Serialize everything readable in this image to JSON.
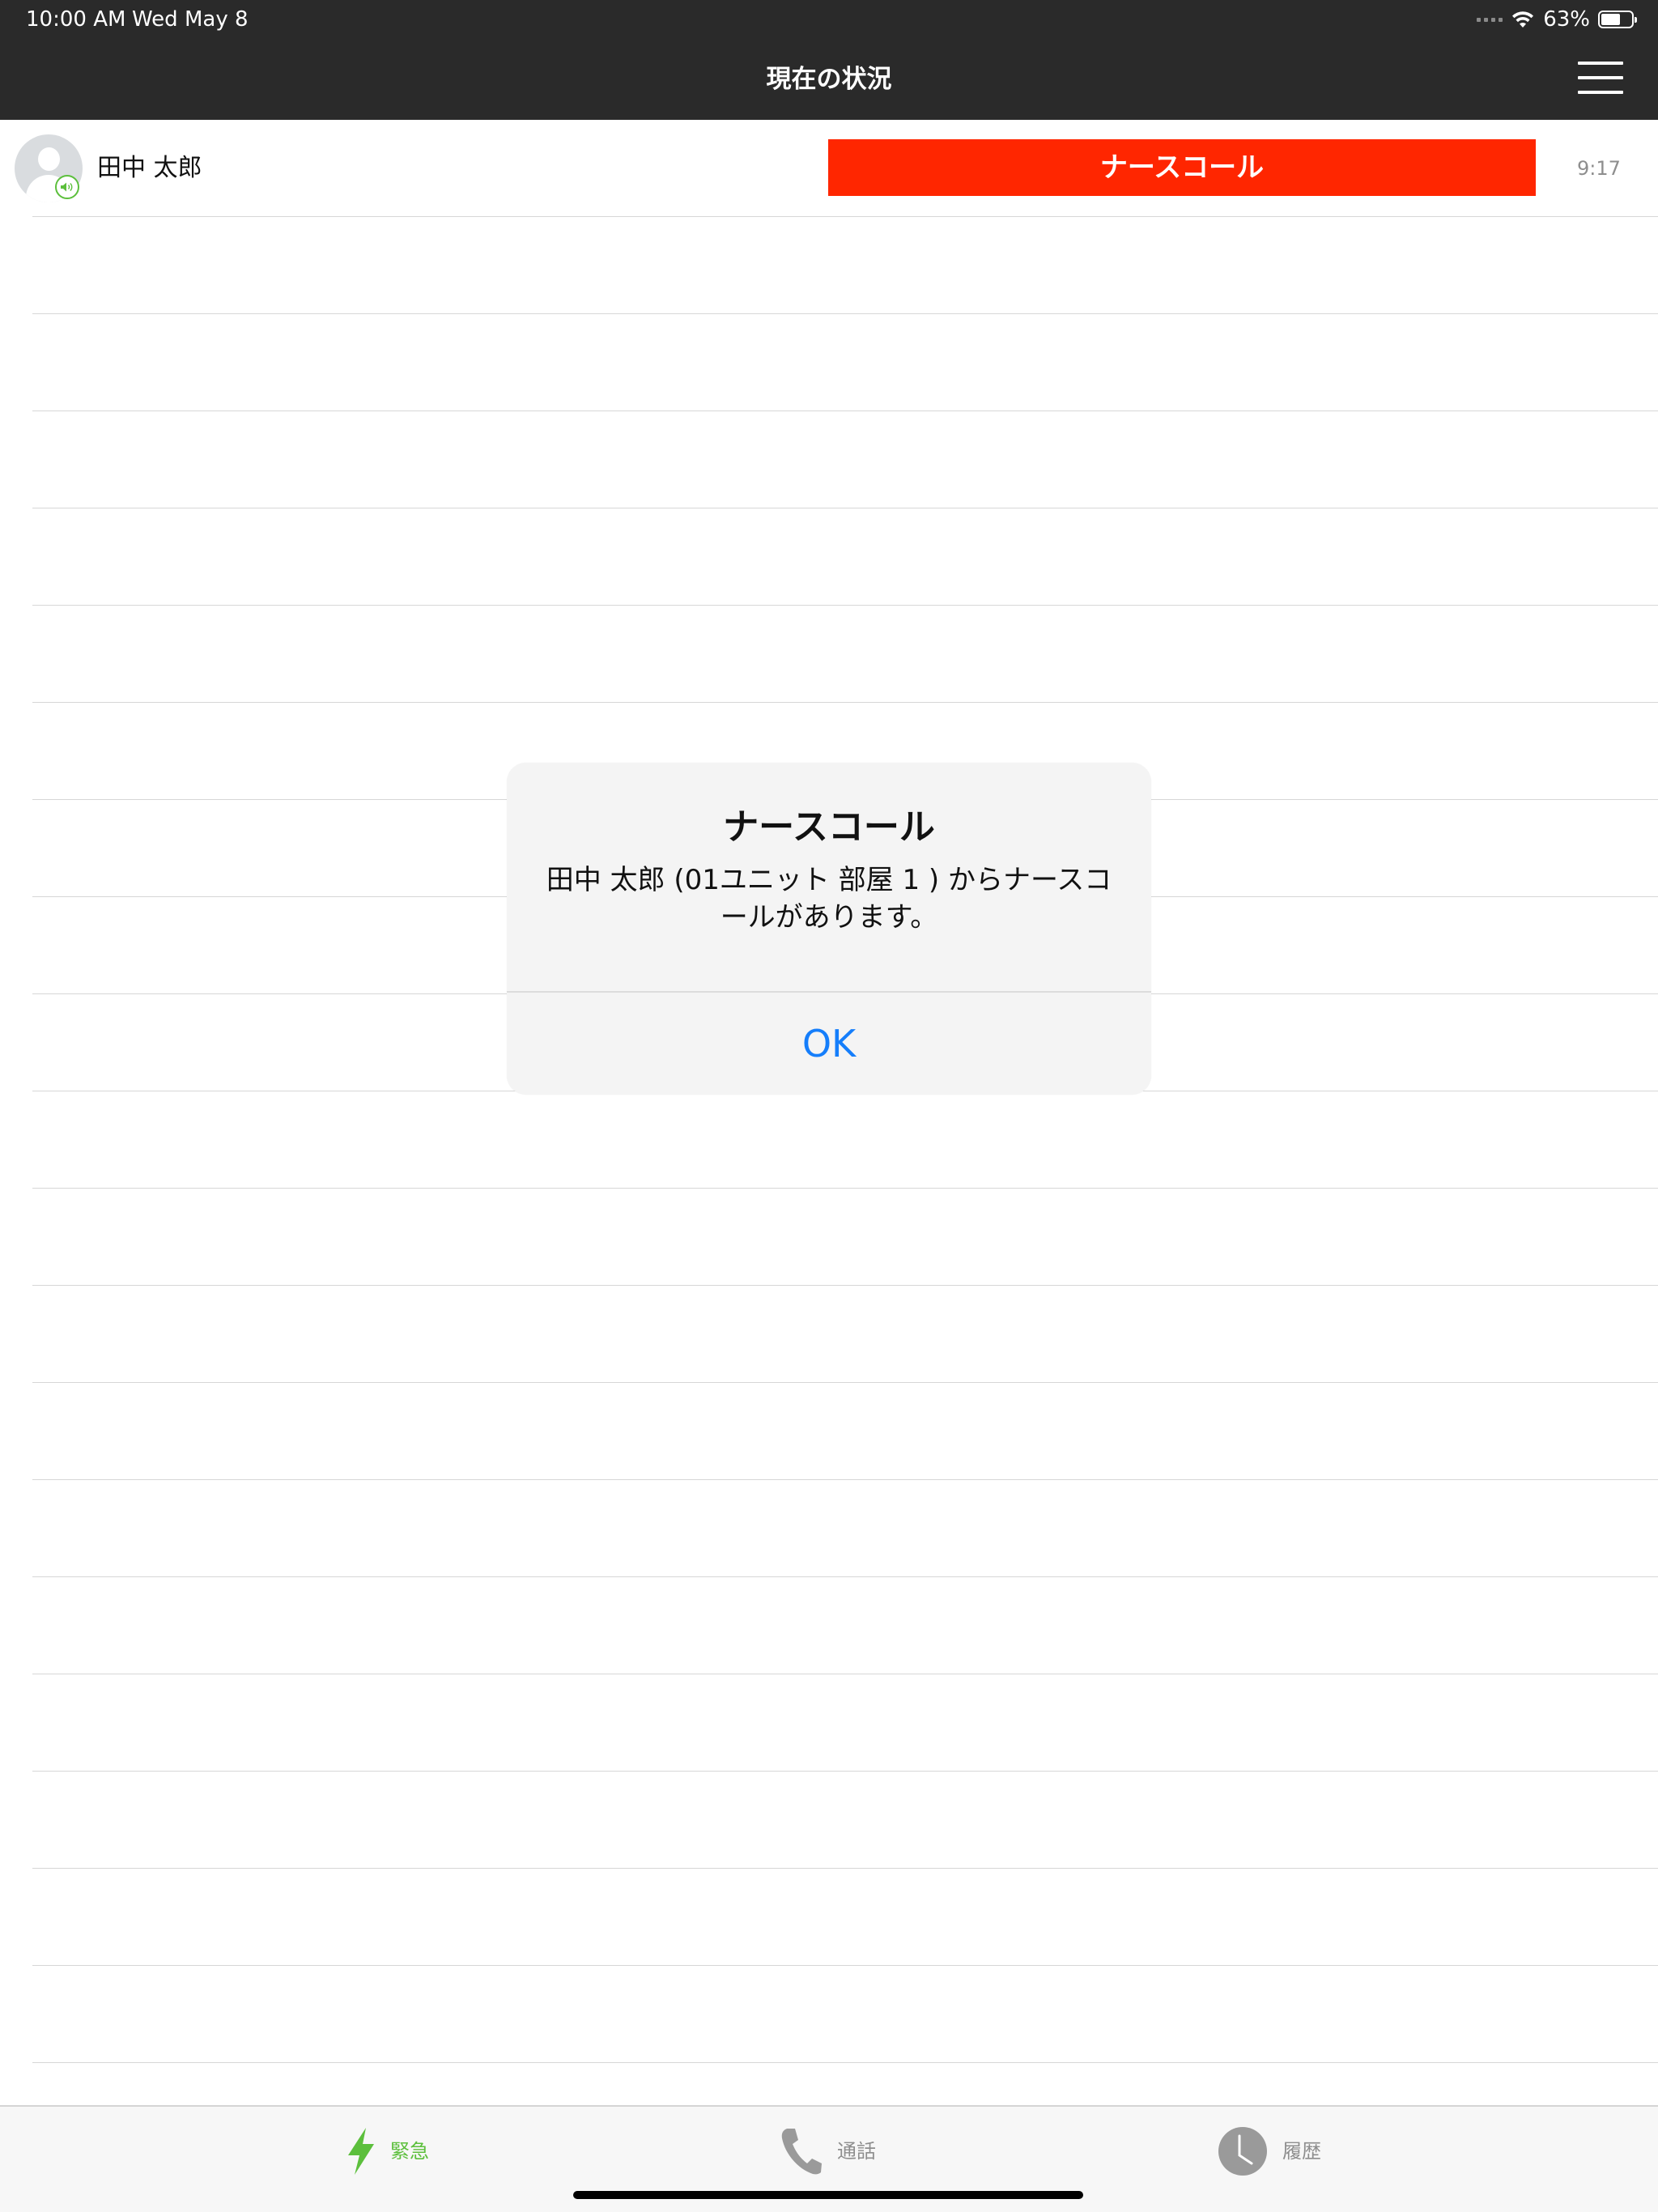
{
  "status_bar": {
    "time": "10:00 AM",
    "date": "Wed May 8",
    "battery": "63%",
    "battery_level": 0.63
  },
  "nav": {
    "title": "現在の状況",
    "menu_icon": "hamburger-icon"
  },
  "list": {
    "rows": [
      {
        "name": "田中 太郎",
        "status": "ナースコール",
        "time": "9:17",
        "status_color": "#ff2600"
      }
    ]
  },
  "alert": {
    "title": "ナースコール",
    "message": "田中 太郎 (01ユニット 部屋 1 ) からナースコールがあります。",
    "ok_label": "OK",
    "ok_color": "#157efb"
  },
  "tabbar": {
    "items": [
      {
        "label": "緊急",
        "icon": "lightning-icon",
        "active": true
      },
      {
        "label": "通話",
        "icon": "phone-icon",
        "active": false
      },
      {
        "label": "履歴",
        "icon": "clock-icon",
        "active": false
      }
    ],
    "active_color": "#5cbf3c",
    "inactive_color": "#8e8e8e"
  }
}
